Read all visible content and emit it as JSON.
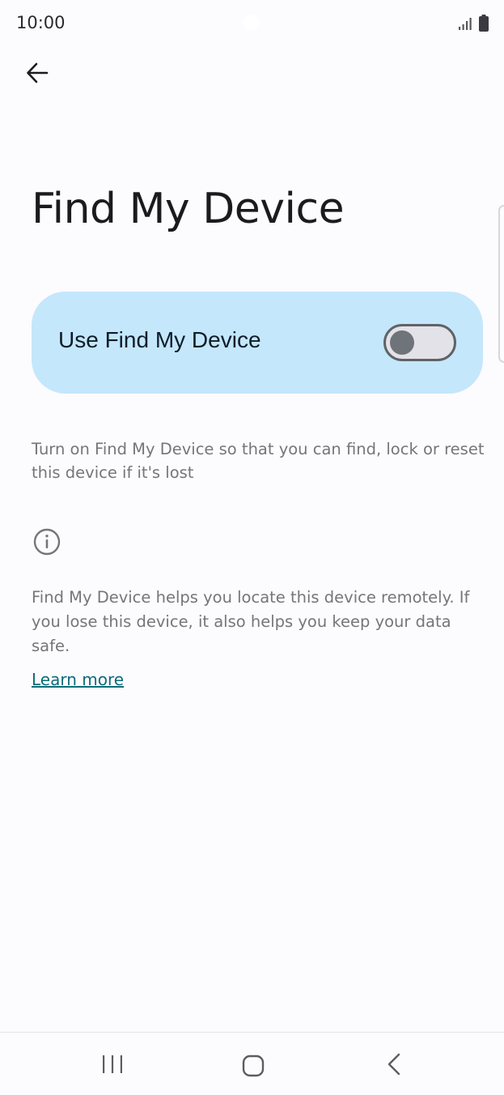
{
  "status_bar": {
    "time": "10:00",
    "signal_icon": "signal-bars-icon",
    "battery_icon": "battery-icon"
  },
  "header": {
    "back_icon": "arrow-back-icon"
  },
  "page": {
    "title": "Find My Device"
  },
  "main_toggle": {
    "label": "Use Find My Device",
    "checked": false,
    "card_color": "#c4e7fb"
  },
  "description": "Turn on Find My Device so that you can find, lock or reset this device if it's lost",
  "info": {
    "icon": "info-icon",
    "text": "Find My Device helps you locate this device remotely. If you lose this device, it also helps you keep your data safe.",
    "link_label": "Learn more",
    "link_color": "#0d6b78"
  },
  "nav_bar": {
    "recents_icon": "recents-icon",
    "home_icon": "home-icon",
    "back_icon": "nav-back-icon"
  }
}
